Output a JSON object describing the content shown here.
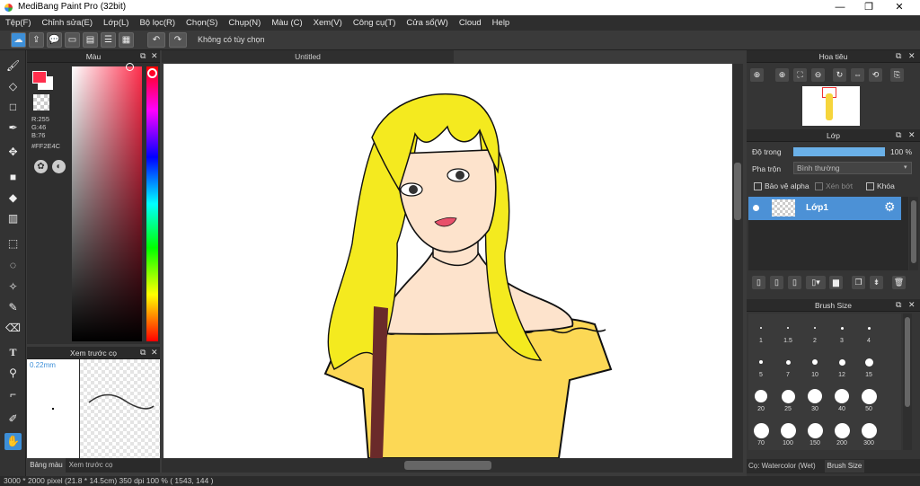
{
  "app": {
    "title": "MediBang Paint Pro (32bit)"
  },
  "window_controls": {
    "minimize": "—",
    "maximize": "❐",
    "close": "✕"
  },
  "menu": [
    "Tệp(F)",
    "Chỉnh sửa(E)",
    "Lớp(L)",
    "Bộ lọc(R)",
    "Chọn(S)",
    "Chụp(N)",
    "Màu (C)",
    "Xem(V)",
    "Công cụ(T)",
    "Cửa sổ(W)",
    "Cloud",
    "Help"
  ],
  "toolbar": {
    "selection_hint": "Không có tùy chọn"
  },
  "color_panel": {
    "title": "Màu",
    "r": "R:255",
    "g": "G:46",
    "b": "B:76",
    "hex": "#FF2E4C",
    "fg_color": "#FF2E4C",
    "bg_color": "#FFFFFF"
  },
  "brush_preview_panel": {
    "title": "Xem trước cọ",
    "size": "0.22mm"
  },
  "left_tabs": {
    "color": "Bảng màu",
    "preview": "Xem trước cọ"
  },
  "canvas": {
    "tab_title": "Untitled"
  },
  "navigator": {
    "title": "Hoa tiêu"
  },
  "layer_panel": {
    "title": "Lớp",
    "opacity_label": "Độ trong",
    "opacity_value": "100 %",
    "opacity_level": 1.0,
    "blend_label": "Pha trộn",
    "blend_value": "Bình thường",
    "protect_alpha": "Bảo vệ alpha",
    "clip": "Xén bớt",
    "lock": "Khóa",
    "layer_name": "Lớp1"
  },
  "brush_size_panel": {
    "title": "Brush Size",
    "sizes": [
      "1",
      "1.5",
      "2",
      "3",
      "4",
      "5",
      "7",
      "10",
      "12",
      "15",
      "20",
      "25",
      "30",
      "40",
      "50",
      "70",
      "100",
      "150",
      "200",
      "300"
    ]
  },
  "right_tabs": {
    "brush": "Cọ: Watercolor (Wet)",
    "size": "Brush Size"
  },
  "status": {
    "text": "3000 * 2000 pixel   (21.8 * 14.5cm)   350 dpi   100 %   ( 1543, 144 )"
  }
}
